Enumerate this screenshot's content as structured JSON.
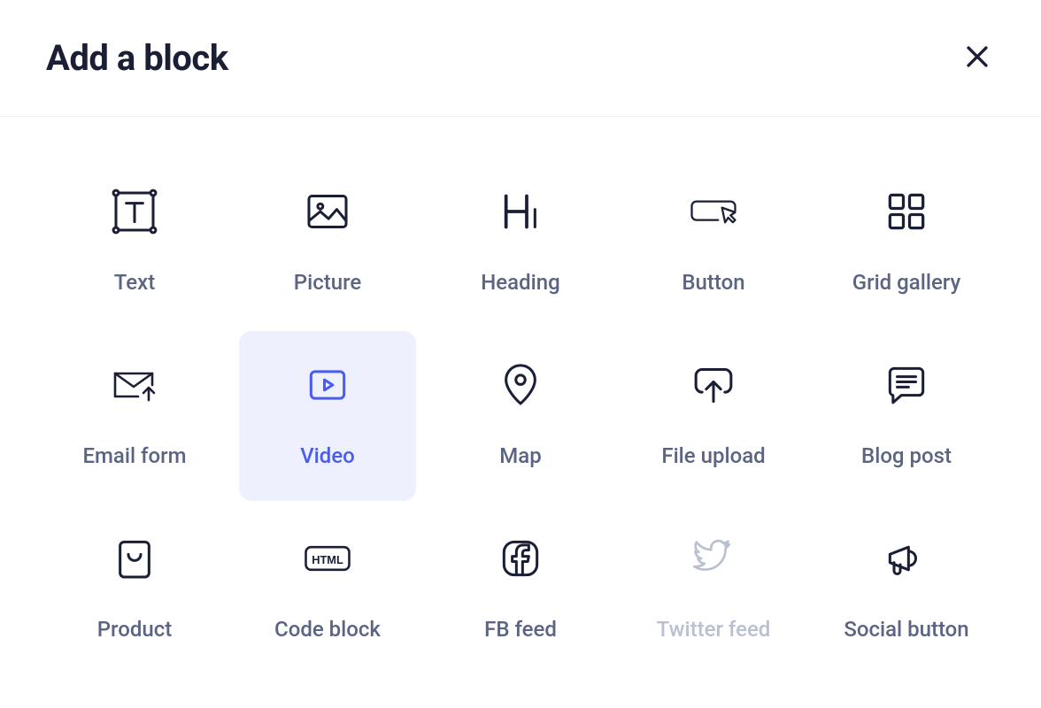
{
  "modal": {
    "title": "Add a block"
  },
  "blocks": {
    "text": {
      "label": "Text",
      "icon": "text-frame-icon"
    },
    "picture": {
      "label": "Picture",
      "icon": "picture-icon"
    },
    "heading": {
      "label": "Heading",
      "icon": "heading-icon"
    },
    "button": {
      "label": "Button",
      "icon": "button-icon"
    },
    "grid_gallery": {
      "label": "Grid gallery",
      "icon": "grid-gallery-icon"
    },
    "email_form": {
      "label": "Email form",
      "icon": "email-form-icon"
    },
    "video": {
      "label": "Video",
      "icon": "video-icon",
      "selected": true
    },
    "map": {
      "label": "Map",
      "icon": "map-pin-icon"
    },
    "file_upload": {
      "label": "File upload",
      "icon": "file-upload-icon"
    },
    "blog_post": {
      "label": "Blog post",
      "icon": "blog-post-icon"
    },
    "product": {
      "label": "Product",
      "icon": "product-icon"
    },
    "code_block": {
      "label": "Code block",
      "icon": "code-html-icon"
    },
    "fb_feed": {
      "label": "FB feed",
      "icon": "facebook-icon"
    },
    "twitter_feed": {
      "label": "Twitter feed",
      "icon": "twitter-icon",
      "disabled": true
    },
    "social_button": {
      "label": "Social button",
      "icon": "megaphone-icon"
    }
  }
}
